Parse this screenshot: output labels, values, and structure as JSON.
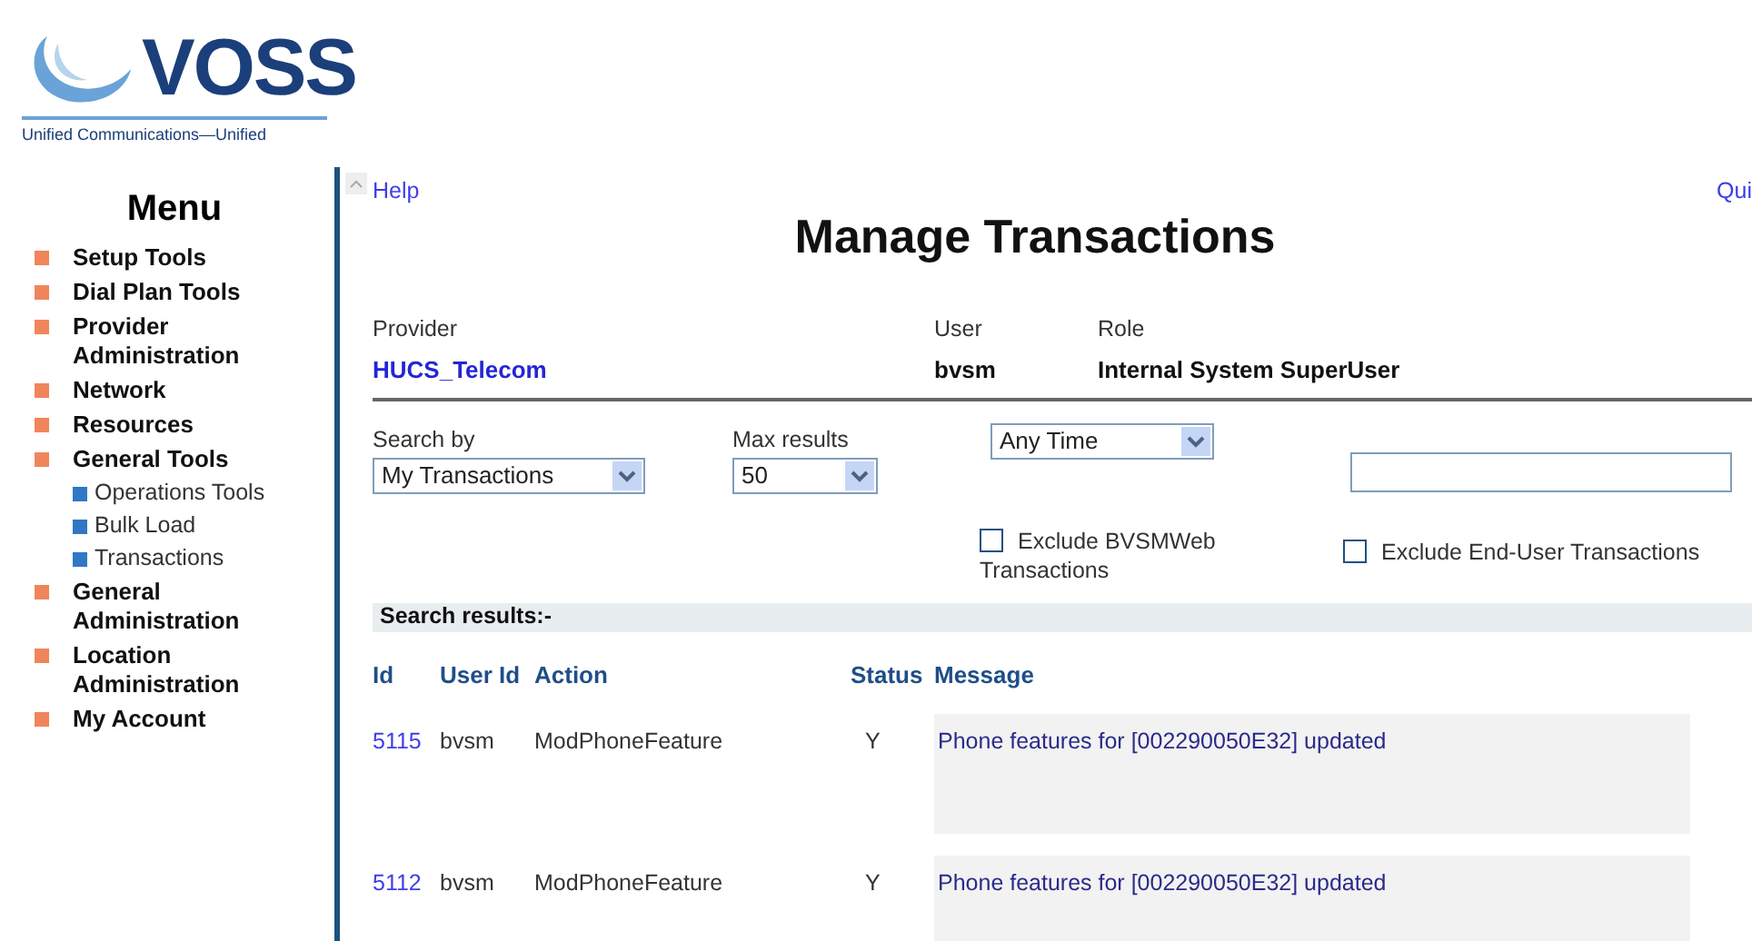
{
  "logo": {
    "name": "VOSS",
    "tagline": "Unified Communications—Unified"
  },
  "menu": {
    "title": "Menu",
    "items": [
      {
        "label": "Setup Tools"
      },
      {
        "label": "Dial Plan Tools"
      },
      {
        "label": "Provider Administration"
      },
      {
        "label": "Network"
      },
      {
        "label": "Resources"
      },
      {
        "label": "General Tools",
        "children": [
          {
            "label": "Operations Tools"
          },
          {
            "label": "Bulk Load"
          },
          {
            "label": "Transactions"
          }
        ]
      },
      {
        "label": "General Administration"
      },
      {
        "label": "Location Administration"
      },
      {
        "label": "My Account"
      }
    ]
  },
  "header": {
    "help": "Help",
    "quick": "Qui",
    "title": "Manage Transactions"
  },
  "info": [
    {
      "label": "Provider",
      "value": "HUCS_Telecom",
      "kind": "link"
    },
    {
      "label": "User",
      "value": "bvsm",
      "kind": "text"
    },
    {
      "label": "Role",
      "value": "Internal System SuperUser",
      "kind": "text"
    }
  ],
  "search_by": {
    "label": "Search by",
    "value": "My Transactions"
  },
  "max_results": {
    "label": "Max results",
    "value": "50"
  },
  "time_range": {
    "value": "Any Time"
  },
  "checkboxes": [
    {
      "label": "Exclude BVSMWeb Transactions",
      "checked": false
    },
    {
      "label": "Exclude End-User Transactions",
      "checked": false
    }
  ],
  "results": {
    "title": "Search results:-",
    "columns": [
      "Id",
      "User Id",
      "Action",
      "Status",
      "Message"
    ],
    "rows": [
      {
        "id": "5115",
        "user_id": "bvsm",
        "action": "ModPhoneFeature",
        "status": "Y",
        "message": "Phone features for [002290050E32] updated"
      },
      {
        "id": "5112",
        "user_id": "bvsm",
        "action": "ModPhoneFeature",
        "status": "Y",
        "message": "Phone features for [002290050E32] updated"
      }
    ]
  }
}
